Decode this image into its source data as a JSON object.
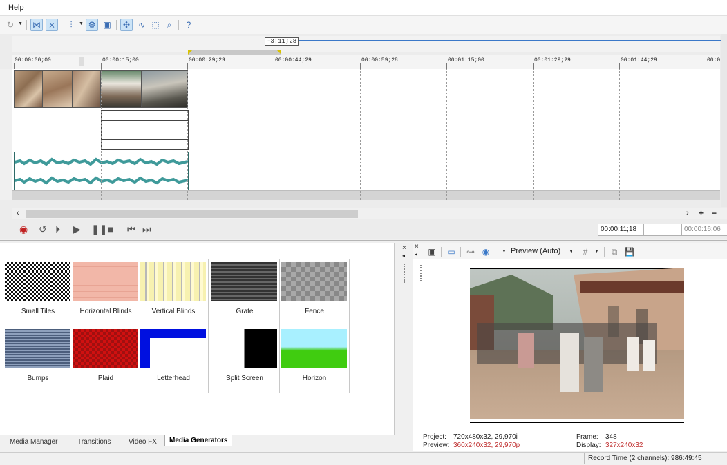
{
  "menu": {
    "help": "Help"
  },
  "timeline": {
    "cursor_time": "-3:11;28",
    "ruler_labels": [
      "00:00:00;00",
      "00:00:15;00",
      "00:00:29;29",
      "00:00:44;29",
      "00:00:59;28",
      "00:01:15;00",
      "00:01:29;29",
      "00:01:44;29",
      "00:0"
    ],
    "time_position": "00:00:11;18",
    "time_end": "00:00:16;06"
  },
  "generators": [
    {
      "label": "Small Tiles",
      "icon": "checker-thumb"
    },
    {
      "label": "Horizontal Blinds",
      "icon": "blinds-h-thumb"
    },
    {
      "label": "Vertical Blinds",
      "icon": "blinds-v-thumb"
    },
    {
      "label": "Grate",
      "icon": "grate-thumb"
    },
    {
      "label": "Fence",
      "icon": "fence-thumb"
    },
    {
      "label": "Bumps",
      "icon": "bumps-thumb"
    },
    {
      "label": "Plaid",
      "icon": "plaid-thumb"
    },
    {
      "label": "Letterhead",
      "icon": "letterhead-thumb"
    },
    {
      "label": "Split Screen",
      "icon": "split-thumb"
    },
    {
      "label": "Horizon",
      "icon": "horizon-thumb"
    }
  ],
  "tabs": [
    "Media Manager",
    "Transitions",
    "Video FX",
    "Media Generators"
  ],
  "preview": {
    "mode_label": "Preview (Auto)",
    "project_label": "Project:",
    "project_value": "720x480x32, 29,970i",
    "preview_label": "Preview:",
    "preview_value": "360x240x32, 29,970p",
    "frame_label": "Frame:",
    "frame_value": "348",
    "display_label": "Display:",
    "display_value": "327x240x32"
  },
  "status": {
    "record_time": "Record Time (2 channels): 986:49:45"
  },
  "colors": {
    "accent": "#3a78c8",
    "audio": "#3f9a9a",
    "red_value": "#c03030"
  }
}
